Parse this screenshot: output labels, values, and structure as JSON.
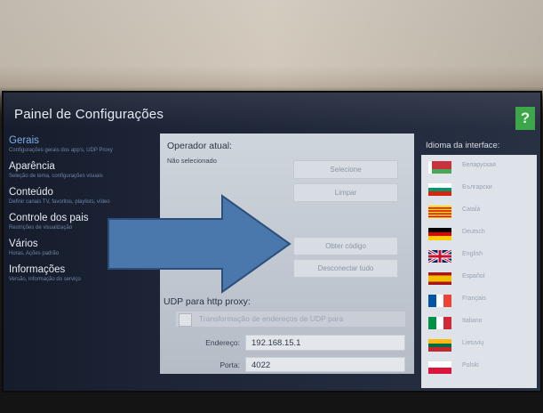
{
  "app": {
    "title": "Painel de Configurações",
    "help_label": "?"
  },
  "sidebar": {
    "items": [
      {
        "label": "Gerais",
        "sub": "Configurações gerais dos app's, UDP Proxy",
        "active": true
      },
      {
        "label": "Aparência",
        "sub": "Seleção de tema, configurações visuais"
      },
      {
        "label": "Conteúdo",
        "sub": "Definir canais TV, favoritos, playlists, vídeo"
      },
      {
        "label": "Controle dos pais",
        "sub": "Restrições de visualização"
      },
      {
        "label": "Vários",
        "sub": "Horas, Ações padrão"
      },
      {
        "label": "Informações",
        "sub": "Versão, informação do serviço"
      }
    ]
  },
  "operator": {
    "heading": "Operador atual:",
    "value": "Não selecionado",
    "select_label": "Selecione",
    "clear_label": "Limpar"
  },
  "code": {
    "get_code_label": "Obter código",
    "disconnect_label": "Desconectar tudo"
  },
  "udp": {
    "heading": "UDP para http proxy:",
    "checkbox_label": "Transformação de endereços de UDP para",
    "address_label": "Endereço:",
    "address_value": "192.168.15.1",
    "port_label": "Porta:",
    "port_value": "4022"
  },
  "languages": {
    "heading": "Idioma da interface:",
    "items": [
      {
        "name": "Беларуская",
        "icon": "belarus-flag-icon"
      },
      {
        "name": "Български",
        "icon": "bulgaria-flag-icon"
      },
      {
        "name": "Català",
        "icon": "catalonia-flag-icon"
      },
      {
        "name": "Deutsch",
        "icon": "germany-flag-icon"
      },
      {
        "name": "English",
        "icon": "uk-flag-icon"
      },
      {
        "name": "Español",
        "icon": "spain-flag-icon"
      },
      {
        "name": "Français",
        "icon": "france-flag-icon"
      },
      {
        "name": "Italiano",
        "icon": "italy-flag-icon"
      },
      {
        "name": "Lietuvių",
        "icon": "lithuania-flag-icon"
      },
      {
        "name": "Polski",
        "icon": "poland-flag-icon"
      }
    ]
  },
  "colors": {
    "accent": "#7fb0ea",
    "help_green": "#3ea64a",
    "arrow_fill": "#4a78ad",
    "arrow_stroke": "#2b4f7a"
  }
}
